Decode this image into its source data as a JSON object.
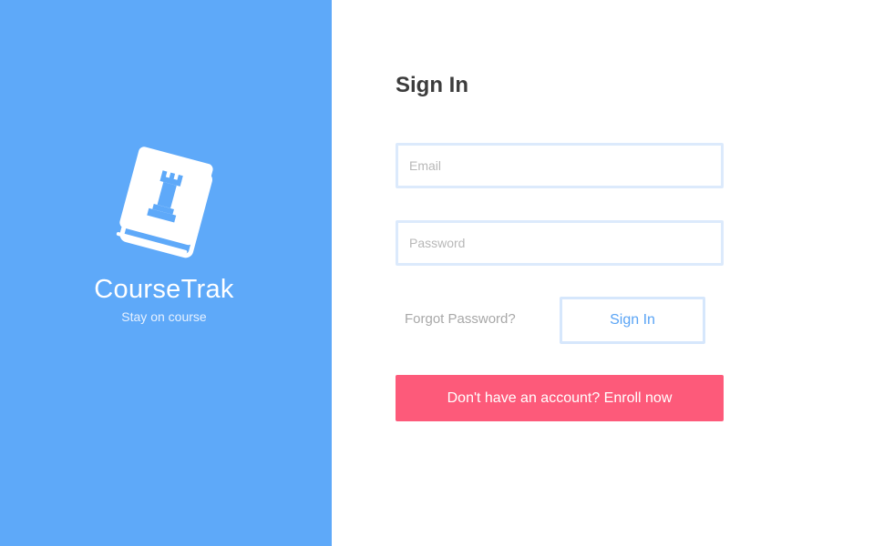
{
  "brand": {
    "name": "CourseTrak",
    "tagline": "Stay on course",
    "panel_color": "#5ea9f9",
    "logo_icon": "book-icon"
  },
  "signin": {
    "title": "Sign In",
    "email_placeholder": "Email",
    "password_placeholder": "Password",
    "forgot_label": "Forgot Password?",
    "submit_label": "Sign In",
    "enroll_label": "Don't have an account? Enroll now",
    "accent_color": "#5aa4f5",
    "enroll_color": "#fd5a7a"
  }
}
